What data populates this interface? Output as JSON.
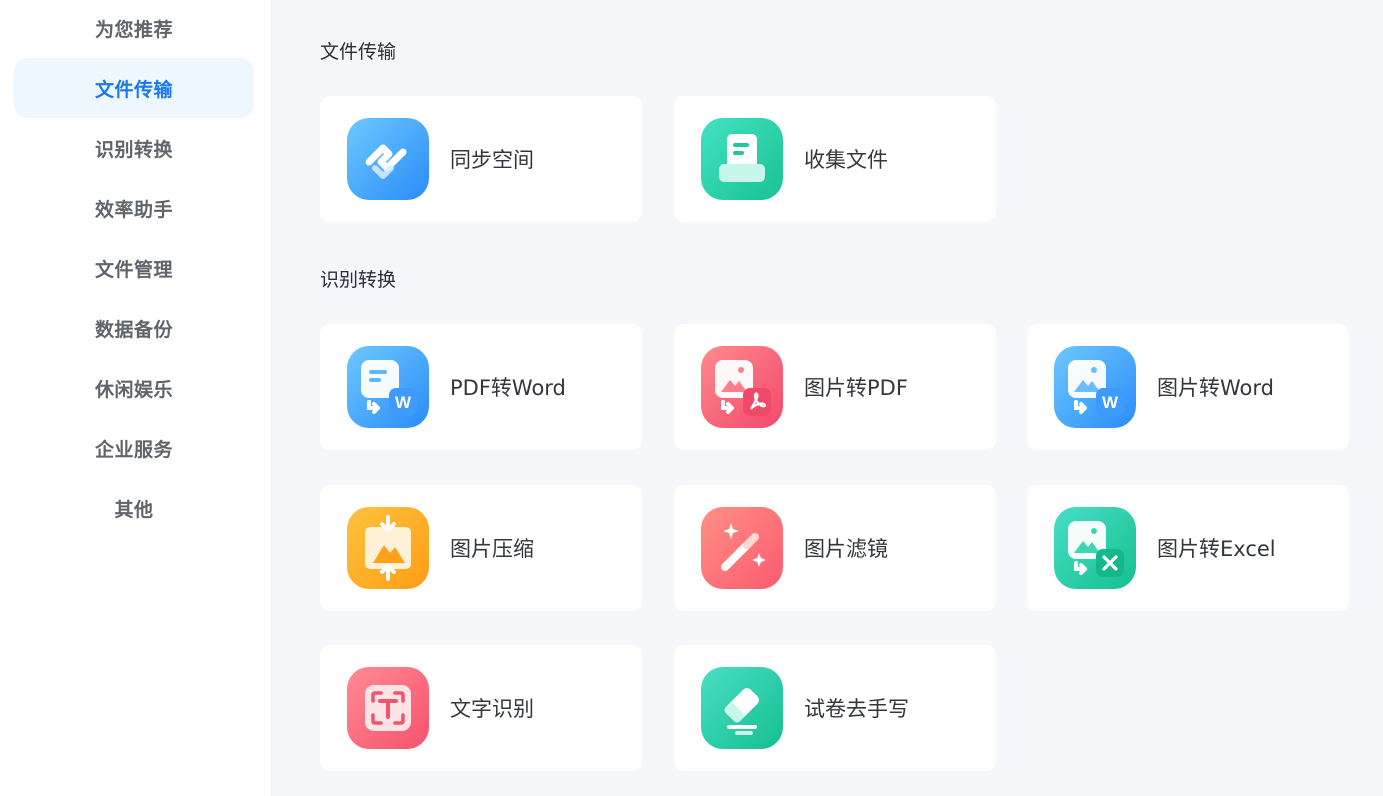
{
  "sidebar": {
    "items": [
      {
        "label": "为您推荐",
        "active": false
      },
      {
        "label": "文件传输",
        "active": true
      },
      {
        "label": "识别转换",
        "active": false
      },
      {
        "label": "效率助手",
        "active": false
      },
      {
        "label": "文件管理",
        "active": false
      },
      {
        "label": "数据备份",
        "active": false
      },
      {
        "label": "休闲娱乐",
        "active": false
      },
      {
        "label": "企业服务",
        "active": false
      },
      {
        "label": "其他",
        "active": false
      }
    ]
  },
  "sections": [
    {
      "title": "文件传输",
      "cards": [
        {
          "label": "同步空间",
          "icon": "sync-space-icon"
        },
        {
          "label": "收集文件",
          "icon": "collect-files-icon"
        }
      ]
    },
    {
      "title": "识别转换",
      "cards": [
        {
          "label": "PDF转Word",
          "icon": "pdf-to-word-icon"
        },
        {
          "label": "图片转PDF",
          "icon": "image-to-pdf-icon"
        },
        {
          "label": "图片转Word",
          "icon": "image-to-word-icon"
        },
        {
          "label": "图片压缩",
          "icon": "image-compress-icon"
        },
        {
          "label": "图片滤镜",
          "icon": "image-filter-icon"
        },
        {
          "label": "图片转Excel",
          "icon": "image-to-excel-icon"
        },
        {
          "label": "文字识别",
          "icon": "text-recognition-icon"
        },
        {
          "label": "试卷去手写",
          "icon": "remove-handwriting-icon"
        }
      ]
    }
  ],
  "colors": {
    "accent": "#1877f2",
    "active_bg": "#eef6ff",
    "page_bg": "#f6f7fb"
  }
}
